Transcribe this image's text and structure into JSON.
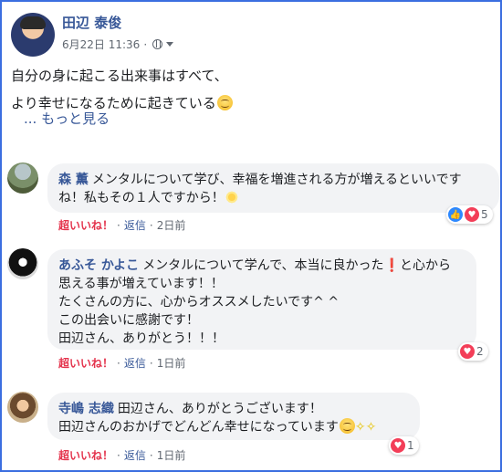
{
  "post": {
    "author": "田辺 泰俊",
    "date": "6月22日 11:36",
    "line1": "自分の身に起こる出来事はすべて、",
    "line2": "より幸せになるために起きている",
    "see_more": "... もっと見る",
    "privacy_icon": "globe-icon"
  },
  "comments": [
    {
      "name": "森 薫",
      "text_line1": "メンタルについて学び、幸福を増進される方が増えるといいです",
      "text_line2": "ね！私もその１人ですから！",
      "like": "超いいね！",
      "reply": "返信",
      "time": "2日前",
      "reaction_count": "5",
      "reaction_icons": [
        "like-icon",
        "love-icon"
      ]
    },
    {
      "name": "あふそ かよこ",
      "text_line1a": "メンタルについて学んで、本当に良かった",
      "text_line1b": "と心から",
      "text_line2": "思える事が増えています！！",
      "text_line3": "たくさんの方に、心からオススメしたいです^ ^",
      "text_line4": "この出会いに感謝です！",
      "text_line5": "田辺さん、ありがとう！！！",
      "like": "超いいね！",
      "reply": "返信",
      "time": "1日前",
      "reaction_count": "2",
      "reaction_icons": [
        "love-icon"
      ]
    },
    {
      "name": "寺嶋 志織",
      "text_line1": "田辺さん、ありがとうございます！",
      "text_line2": "田辺さんのおかげでどんどん幸せになっています",
      "like": "超いいね！",
      "reply": "返信",
      "time": "1日前",
      "reaction_count": "1",
      "reaction_icons": [
        "love-icon"
      ]
    }
  ],
  "colors": {
    "link": "#385898",
    "super_like": "#e4344d",
    "bubble": "#f2f3f5",
    "border": "#3b6ee0"
  }
}
